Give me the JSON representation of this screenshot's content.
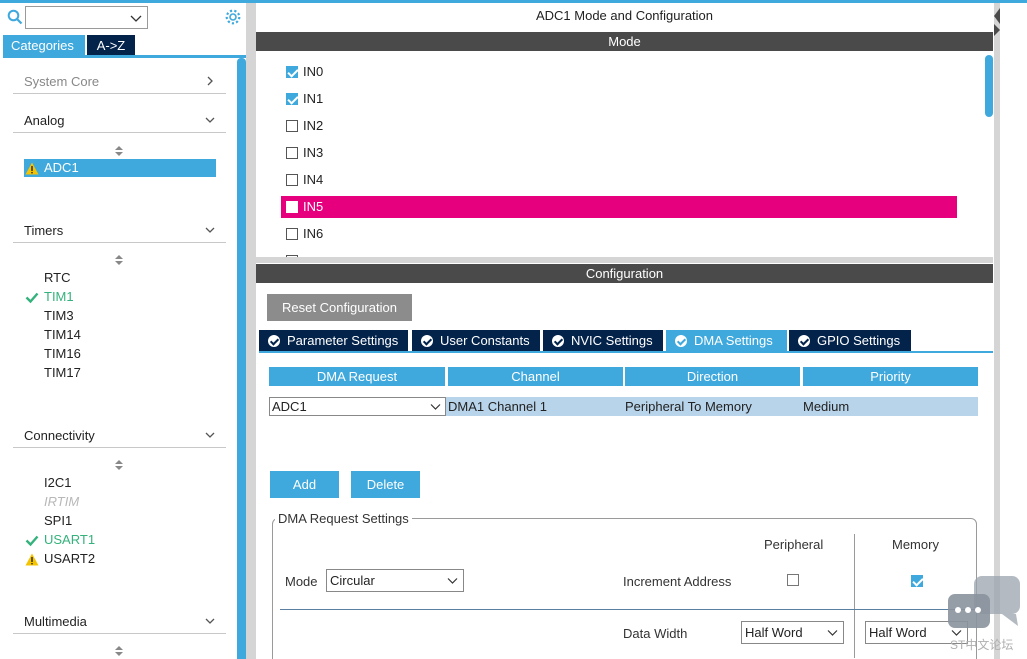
{
  "window": {
    "title": "ADC1 Mode and Configuration"
  },
  "left": {
    "search": {
      "value": ""
    },
    "tabs": [
      {
        "label": "Categories",
        "active": true
      },
      {
        "label": "A->Z",
        "active": false
      }
    ],
    "categories": {
      "system_core": "System Core",
      "analog": "Analog",
      "timers": "Timers",
      "connectivity": "Connectivity",
      "multimedia": "Multimedia"
    },
    "analog_items": [
      {
        "label": "ADC1",
        "status": "warning",
        "selected": true
      }
    ],
    "timer_items": [
      {
        "label": "RTC",
        "status": "none"
      },
      {
        "label": "TIM1",
        "status": "ok"
      },
      {
        "label": "TIM3",
        "status": "none"
      },
      {
        "label": "TIM14",
        "status": "none"
      },
      {
        "label": "TIM16",
        "status": "none"
      },
      {
        "label": "TIM17",
        "status": "none"
      }
    ],
    "connectivity_items": [
      {
        "label": "I2C1",
        "status": "none"
      },
      {
        "label": "IRTIM",
        "status": "disabled"
      },
      {
        "label": "SPI1",
        "status": "none"
      },
      {
        "label": "USART1",
        "status": "ok"
      },
      {
        "label": "USART2",
        "status": "warning"
      }
    ]
  },
  "mode": {
    "header": "Mode",
    "channels": [
      {
        "label": "IN0",
        "checked": true
      },
      {
        "label": "IN1",
        "checked": true
      },
      {
        "label": "IN2",
        "checked": false
      },
      {
        "label": "IN3",
        "checked": false
      },
      {
        "label": "IN4",
        "checked": false
      },
      {
        "label": "IN5",
        "checked": false,
        "highlighted": true
      },
      {
        "label": "IN6",
        "checked": false
      }
    ]
  },
  "configuration": {
    "header": "Configuration",
    "reset_label": "Reset Configuration",
    "tabs": [
      {
        "label": "Parameter Settings",
        "active": false
      },
      {
        "label": "User Constants",
        "active": false
      },
      {
        "label": "NVIC Settings",
        "active": false
      },
      {
        "label": "DMA Settings",
        "active": true
      },
      {
        "label": "GPIO Settings",
        "active": false
      }
    ],
    "dma_table": {
      "headers": [
        "DMA Request",
        "Channel",
        "Direction",
        "Priority"
      ],
      "rows": [
        {
          "request": "ADC1",
          "channel": "DMA1 Channel 1",
          "direction": "Peripheral To Memory",
          "priority": "Medium"
        }
      ]
    },
    "add_label": "Add",
    "delete_label": "Delete",
    "settings": {
      "legend": "DMA Request Settings",
      "col_peripheral": "Peripheral",
      "col_memory": "Memory",
      "mode_label": "Mode",
      "mode_value": "Circular",
      "increment_label": "Increment Address",
      "increment_peripheral": false,
      "increment_memory": true,
      "data_width_label": "Data Width",
      "data_width_peripheral": "Half Word",
      "data_width_memory": "Half Word"
    }
  },
  "watermark": {
    "text": "ST中文论坛"
  },
  "colors": {
    "accent": "#3fa9dd",
    "navy": "#03234b",
    "highlight": "#e6007e",
    "ok": "#34b27b",
    "warning": "#f5c400"
  }
}
